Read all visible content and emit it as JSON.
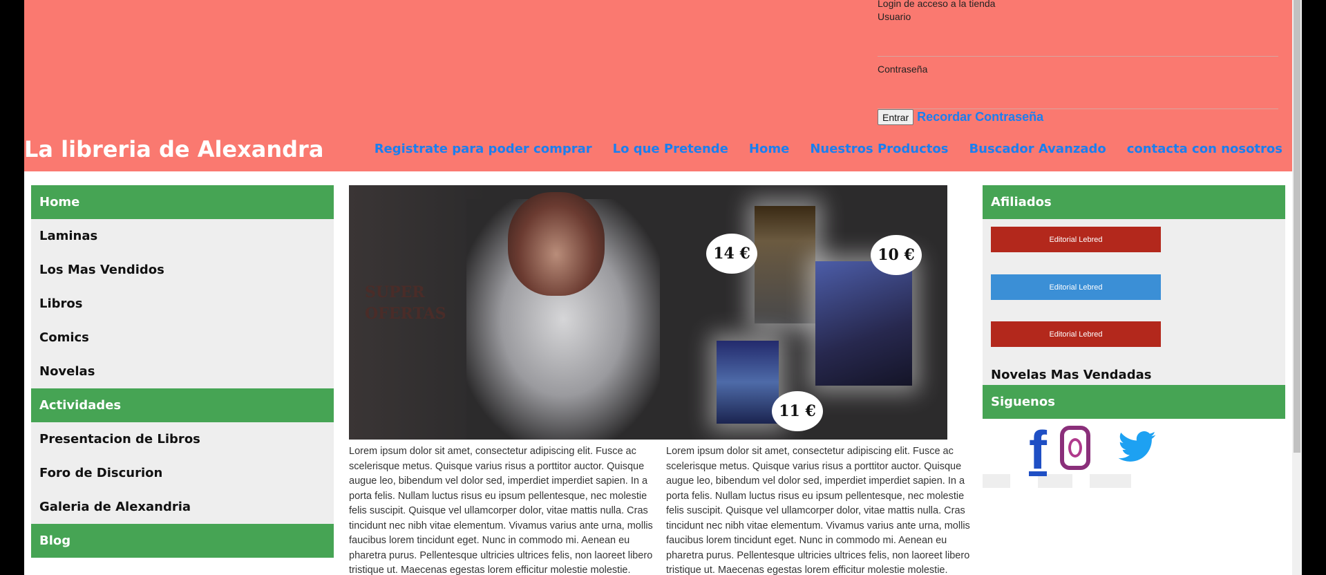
{
  "login": {
    "title": "Login de acceso a la tienda",
    "user_label": "Usuario",
    "pass_label": "Contraseña",
    "enter_button": "Entrar",
    "remember_link": "Recordar Contraseña"
  },
  "header": {
    "site_title": "La libreria de Alexandra",
    "nav": [
      "Registrate para poder comprar",
      "Lo que Pretende",
      "Home",
      "Nuestros Productos",
      "Buscador Avanzado",
      "contacta con nosotros"
    ]
  },
  "sidebar": {
    "items": [
      {
        "label": "Home",
        "header": true
      },
      {
        "label": "Laminas",
        "header": false
      },
      {
        "label": "Los Mas Vendidos",
        "header": false
      },
      {
        "label": "Libros",
        "header": false
      },
      {
        "label": "Comics",
        "header": false
      },
      {
        "label": "Novelas",
        "header": false
      },
      {
        "label": "Actividades",
        "header": true
      },
      {
        "label": "Presentacion de Libros",
        "header": false
      },
      {
        "label": "Foro de Discurion",
        "header": false
      },
      {
        "label": "Galeria de Alexandria",
        "header": false
      },
      {
        "label": "Blog",
        "header": true
      }
    ]
  },
  "banner": {
    "title_line1": "SUPER",
    "title_line2": "OFERTAS",
    "prices": [
      "14 €",
      "10 €",
      "11 €"
    ]
  },
  "main": {
    "lorem": "Lorem ipsum dolor sit amet, consectetur adipiscing elit. Fusce ac scelerisque metus. Quisque varius risus a porttitor auctor. Quisque augue leo, bibendum vel dolor sed, imperdiet imperdiet sapien. In a porta felis. Nullam luctus risus eu ipsum pellentesque, nec molestie felis suscipit. Quisque vel ullamcorper dolor, vitae mattis nulla. Cras tincidunt nec nibh vitae elementum. Vivamus varius ante urna, mollis faucibus lorem tincidunt eget. Nunc in commodo mi. Aenean eu pharetra purus. Pellentesque ultricies ultrices felis, non laoreet libero tristique ut. Maecenas egestas lorem efficitur molestie molestie."
  },
  "right": {
    "affiliates_title": "Afiliados",
    "affiliates": [
      "Editorial Lebred",
      "Editorial Lebred",
      "Editorial Lebred"
    ],
    "bestsellers_title": "Novelas Mas Vendadas",
    "follow_title": "Siguenos",
    "social_icons": [
      "facebook-icon",
      "instagram-icon",
      "twitter-icon"
    ]
  },
  "colors": {
    "header_bg": "#fa7970",
    "menu_green": "#46a454",
    "link_blue": "#1a7ff0",
    "affiliate_red": "#b3281c",
    "affiliate_blue": "#3b8fd6"
  }
}
